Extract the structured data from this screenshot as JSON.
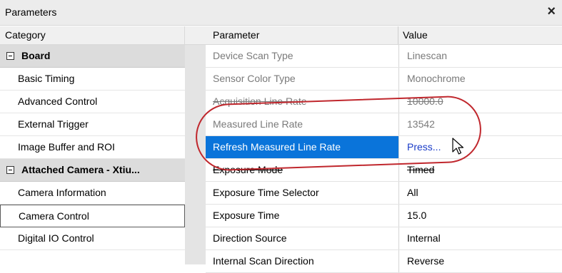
{
  "window": {
    "title": "Parameters",
    "close_glyph": "×"
  },
  "category_pane": {
    "header": "Category",
    "rows": [
      {
        "type": "group",
        "label": "Board"
      },
      {
        "type": "item",
        "label": "Basic Timing"
      },
      {
        "type": "item",
        "label": "Advanced Control"
      },
      {
        "type": "item",
        "label": "External Trigger"
      },
      {
        "type": "item",
        "label": "Image Buffer and ROI"
      },
      {
        "type": "group",
        "label": "Attached Camera - Xtiu..."
      },
      {
        "type": "item",
        "label": "Camera Information"
      },
      {
        "type": "item",
        "label": "Camera Control",
        "selected": true
      },
      {
        "type": "item",
        "label": "Digital IO Control"
      }
    ]
  },
  "parameter_pane": {
    "headers": {
      "parameter": "Parameter",
      "value": "Value"
    },
    "rows": [
      {
        "name": "Device Scan Type",
        "value": "Linescan",
        "state": "readonly"
      },
      {
        "name": "Sensor Color Type",
        "value": "Monochrome",
        "state": "readonly"
      },
      {
        "name": "Acquisition Line Rate",
        "value": "10000.0",
        "state": "struck"
      },
      {
        "name": "Measured Line Rate",
        "value": "13542",
        "state": "readonly"
      },
      {
        "name": "Refresh Measured Line Rate",
        "value": "Press...",
        "state": "selected"
      },
      {
        "name": "Exposure Mode",
        "value": "Timed",
        "state": "struck-dark"
      },
      {
        "name": "Exposure Time Selector",
        "value": "All",
        "state": "normal"
      },
      {
        "name": "Exposure Time",
        "value": "15.0",
        "state": "normal"
      },
      {
        "name": "Direction Source",
        "value": "Internal",
        "state": "normal"
      },
      {
        "name": "Internal Scan Direction",
        "value": "Reverse",
        "state": "normal"
      }
    ]
  },
  "colors": {
    "selection": "#0a74da",
    "annotation": "#c0272d",
    "link": "#1a3cc8"
  }
}
